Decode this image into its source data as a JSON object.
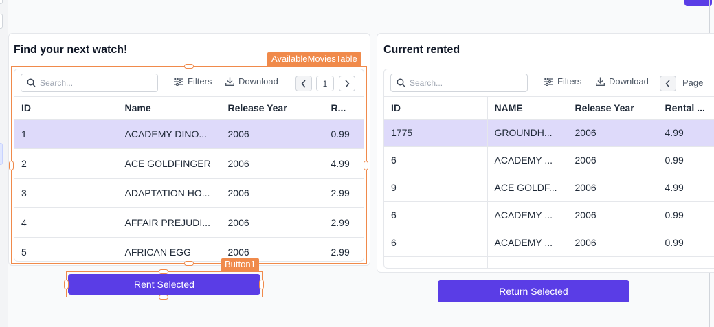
{
  "left_panel": {
    "title": "Find your next watch!",
    "widget_tag": "AvailableMoviesTable",
    "table": {
      "search_placeholder": "Search...",
      "filters_label": "Filters",
      "download_label": "Download",
      "page_number": "1",
      "columns": [
        "ID",
        "Name",
        "Release Year",
        "R..."
      ],
      "rows": [
        [
          "1",
          "ACADEMY DINO...",
          "2006",
          "0.99"
        ],
        [
          "2",
          "ACE GOLDFINGER",
          "2006",
          "4.99"
        ],
        [
          "3",
          "ADAPTATION HO...",
          "2006",
          "2.99"
        ],
        [
          "4",
          "AFFAIR PREJUDI...",
          "2006",
          "2.99"
        ],
        [
          "5",
          "AFRICAN EGG",
          "2006",
          "2.99"
        ]
      ],
      "selected_row": 0
    },
    "button_tag": "Button1",
    "button_label": "Rent Selected"
  },
  "right_panel": {
    "title": "Current rented",
    "table": {
      "search_placeholder": "Search...",
      "filters_label": "Filters",
      "download_label": "Download",
      "page_label": "Page",
      "columns": [
        "ID",
        "NAME",
        "Release Year",
        "Rental ..."
      ],
      "rows": [
        [
          "1775",
          "GROUNDH...",
          "2006",
          "4.99"
        ],
        [
          "6",
          "ACADEMY ...",
          "2006",
          "0.99"
        ],
        [
          "9",
          "ACE GOLDF...",
          "2006",
          "4.99"
        ],
        [
          "6",
          "ACADEMY ...",
          "2006",
          "0.99"
        ],
        [
          "6",
          "ACADEMY ...",
          "2006",
          "0.99"
        ]
      ],
      "selected_row": 0
    },
    "button_label": "Return Selected"
  },
  "colors": {
    "accent": "#5a3de6",
    "selection_outline": "#f08a4b",
    "row_selected": "#dedafa"
  }
}
